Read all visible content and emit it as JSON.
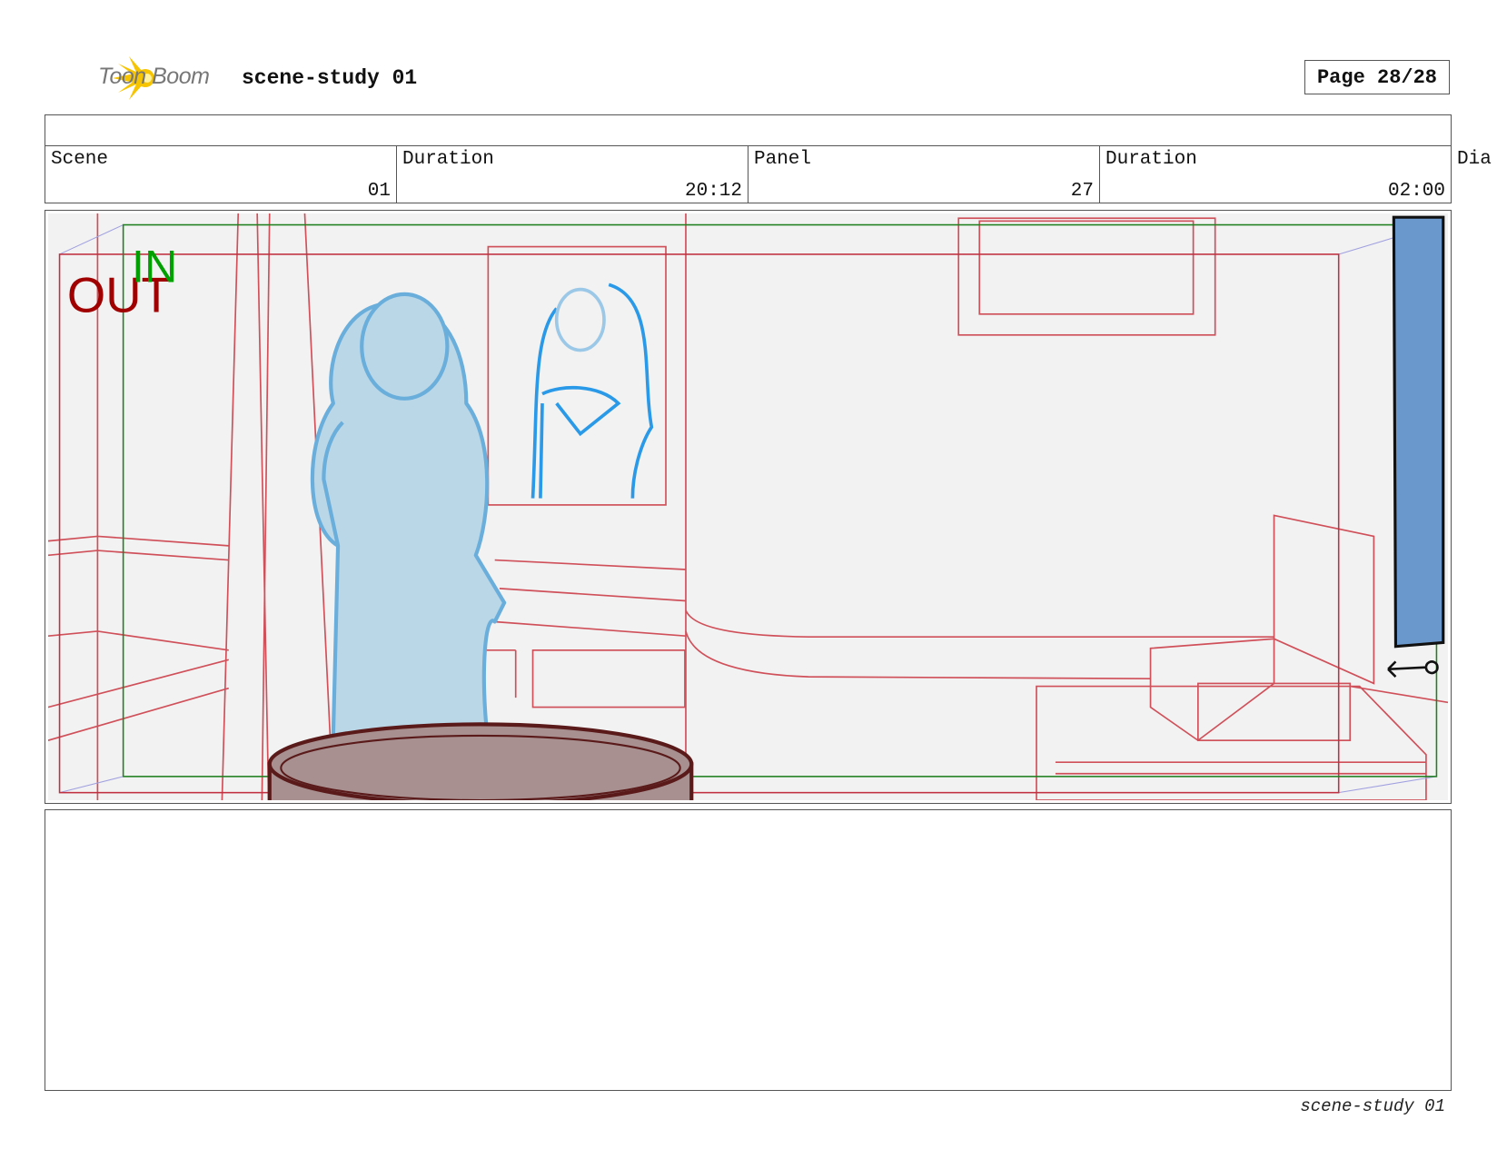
{
  "header": {
    "logo_text": "Toon Boom",
    "project_title": "scene-study 01",
    "page_label": "Page 28/28"
  },
  "info": {
    "scene_label": "Scene",
    "scene_value": "01",
    "scene_duration_label": "Duration",
    "scene_duration_value": "20:12",
    "panel_label": "Panel",
    "panel_value": "27",
    "panel_duration_label": "Duration",
    "panel_duration_value": "02:00",
    "dialog_label": "Dia"
  },
  "panel_image": {
    "in_marker": "IN",
    "out_marker": "OUT",
    "colors": {
      "out": "#a00000",
      "in": "#00a000",
      "layout": "#d0505a",
      "character": "#6aaedc",
      "curtain": "#6a98cc"
    }
  },
  "footer": {
    "text": "scene-study 01"
  }
}
